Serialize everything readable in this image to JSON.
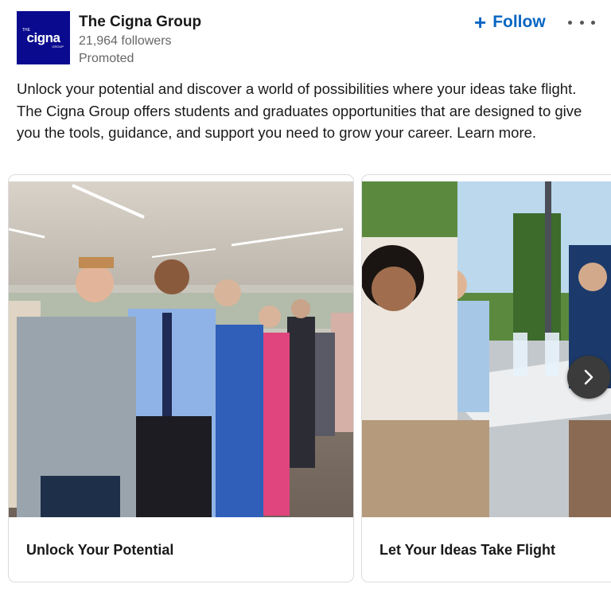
{
  "header": {
    "logo_text": "cigna",
    "logo_sup": "THE",
    "logo_sub": "GROUP",
    "company_name": "The Cigna Group",
    "followers": "21,964 followers",
    "promoted": "Promoted",
    "follow_label": "Follow"
  },
  "post": {
    "description": "Unlock your potential and discover a world of possibilities where your ideas take flight. The Cigna Group offers students and graduates opportunities that are designed to give you the tools, guidance, and support you need to grow your career. Learn more."
  },
  "carousel": {
    "cards": [
      {
        "title": "Unlock Your Potential"
      },
      {
        "title": "Let Your Ideas Take Flight"
      }
    ]
  },
  "icons": {
    "follow": "plus-icon",
    "menu": "more-icon",
    "next": "chevron-right-icon"
  },
  "colors": {
    "brand": "#0a0a8f",
    "accent": "#0a66c2"
  }
}
